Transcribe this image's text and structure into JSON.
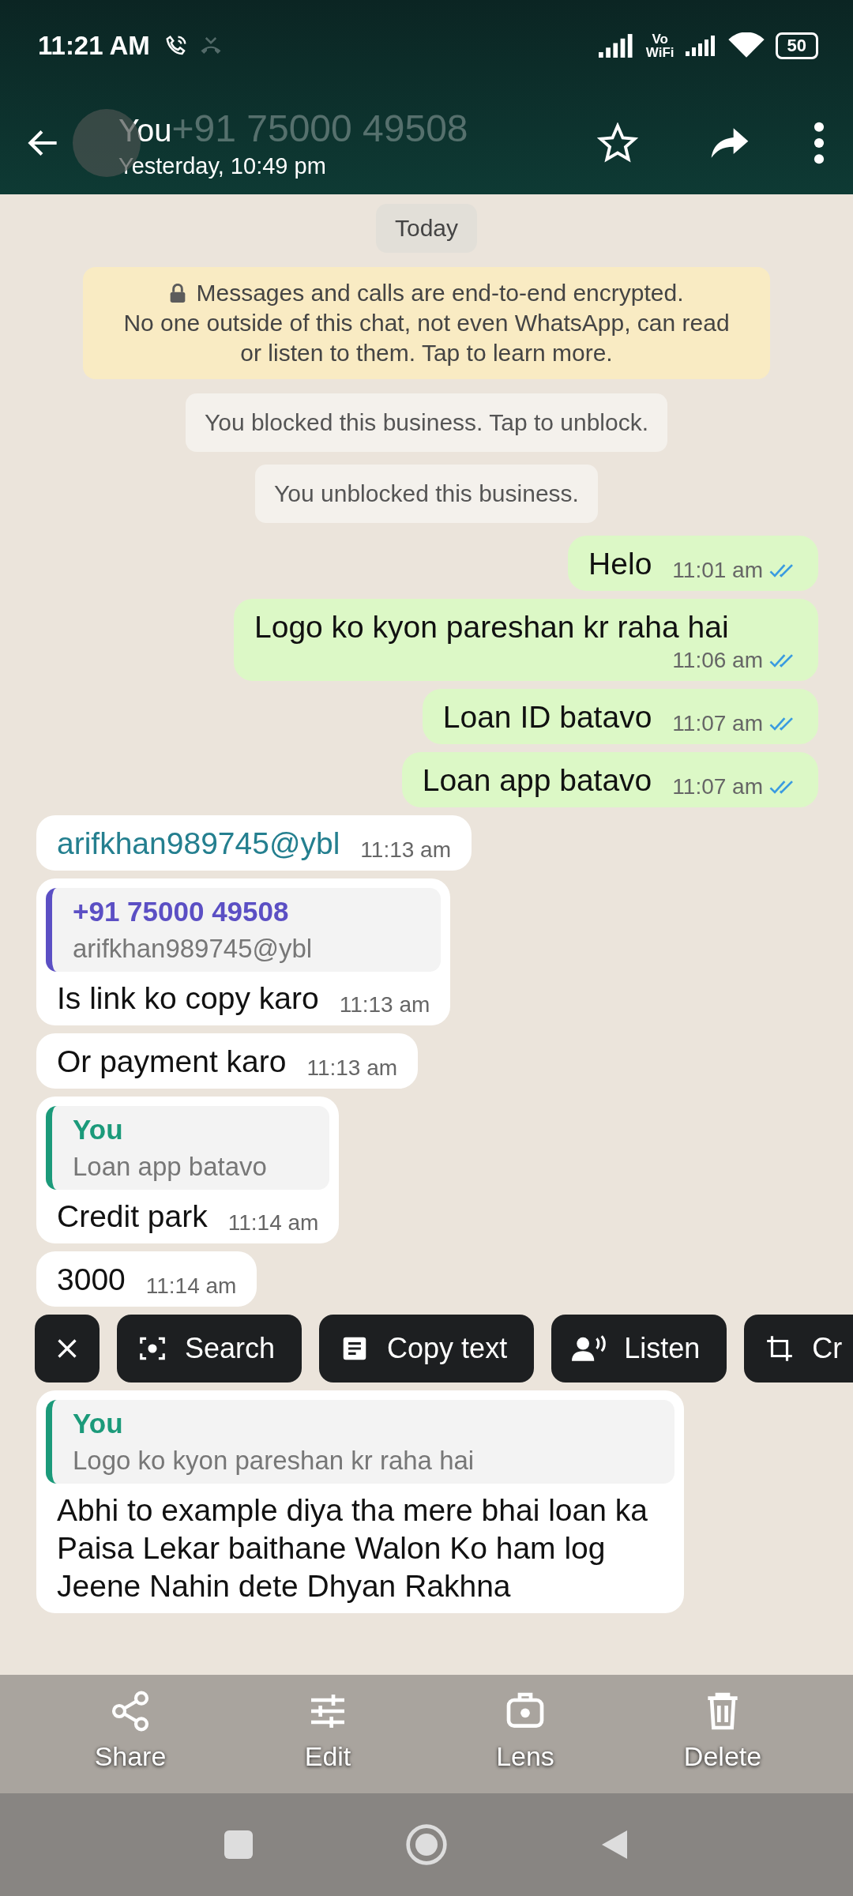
{
  "status_bar": {
    "time": "11:21 AM",
    "vowifi_top": "Vo",
    "vowifi_bottom": "WiFi",
    "battery": "50"
  },
  "header": {
    "name": "You",
    "ghost_number": "+91 75000 49508",
    "subtitle": "Yesterday, 10:49 pm"
  },
  "chat": {
    "date_chip": "Today",
    "encryption_title": "Messages and calls are end-to-end encrypted.",
    "encryption_body": "No one outside of this chat, not even WhatsApp, can read or listen to them. Tap to learn more.",
    "system_messages": [
      "You blocked this business. Tap to unblock.",
      "You unblocked this business."
    ],
    "messages": [
      {
        "kind": "outgoing",
        "text": "Helo",
        "time": "11:01 am",
        "read": true
      },
      {
        "kind": "outgoing",
        "text": "Logo ko kyon pareshan kr raha hai",
        "time": "11:06 am",
        "read": true
      },
      {
        "kind": "outgoing",
        "text": "Loan ID batavo",
        "time": "11:07 am",
        "read": true
      },
      {
        "kind": "outgoing",
        "text": "Loan app batavo",
        "time": "11:07 am",
        "read": true
      },
      {
        "kind": "incoming",
        "text": "arifkhan989745@ybl",
        "time": "11:13 am",
        "is_link": true
      },
      {
        "kind": "incoming",
        "text": "Is link ko copy karo",
        "time": "11:13 am",
        "quote": {
          "author": "+91 75000 49508",
          "text": "arifkhan989745@ybl",
          "color": "#5b4fc4"
        }
      },
      {
        "kind": "incoming",
        "text": "Or payment karo",
        "time": "11:13 am"
      },
      {
        "kind": "incoming",
        "text": "Credit park",
        "time": "11:14 am",
        "quote": {
          "author": "You",
          "text": "Loan app batavo",
          "color": "#1b9a7a"
        }
      },
      {
        "kind": "incoming",
        "text": "3000",
        "time": "11:14 am"
      },
      {
        "kind": "incoming",
        "text": "Abhi to example diya tha mere bhai loan ka Paisa Lekar baithane Walon Ko ham log Jeene Nahin dete Dhyan Rakhna",
        "quote": {
          "author": "You",
          "text": "Logo ko kyon pareshan kr raha hai",
          "color": "#1b9a7a"
        }
      }
    ]
  },
  "lens_chips": [
    {
      "kind": "close"
    },
    {
      "kind": "search",
      "label": "Search"
    },
    {
      "kind": "copy",
      "label": "Copy text"
    },
    {
      "kind": "listen",
      "label": "Listen"
    },
    {
      "kind": "crop",
      "label": "Cr"
    }
  ],
  "viewer_toolbar": [
    {
      "kind": "share",
      "label": "Share"
    },
    {
      "kind": "edit",
      "label": "Edit"
    },
    {
      "kind": "lens",
      "label": "Lens"
    },
    {
      "kind": "delete",
      "label": "Delete"
    }
  ]
}
